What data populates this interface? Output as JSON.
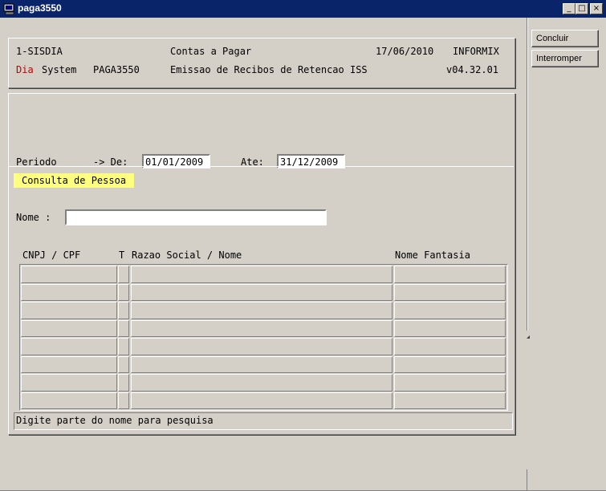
{
  "window": {
    "title": "paga3550",
    "minimize": "_",
    "maximize": "□",
    "close": "×"
  },
  "header": {
    "system": "1-SISDIA",
    "module": "Contas a Pagar",
    "date": "17/06/2010",
    "db": "INFORMIX",
    "brand_red": "Dia",
    "brand_rest": "System",
    "program": "PAGA3550",
    "description": "Emissao de Recibos de Retencao ISS",
    "version": "v04.32.01"
  },
  "period": {
    "label": "Periodo",
    "de_label": "-> De:",
    "de_value": "01/01/2009",
    "ate_label": "Ate:",
    "ate_value": "31/12/2009"
  },
  "consulta": {
    "title": "Consulta de Pessoa"
  },
  "search": {
    "label": "Nome :",
    "value": ""
  },
  "table": {
    "columns": [
      "CNPJ / CPF",
      "T",
      "Razao Social / Nome",
      "Nome Fantasia"
    ],
    "rows": [
      [
        "",
        "",
        "",
        ""
      ],
      [
        "",
        "",
        "",
        ""
      ],
      [
        "",
        "",
        "",
        ""
      ],
      [
        "",
        "",
        "",
        ""
      ],
      [
        "",
        "",
        "",
        ""
      ],
      [
        "",
        "",
        "",
        ""
      ],
      [
        "",
        "",
        "",
        ""
      ],
      [
        "",
        "",
        "",
        ""
      ]
    ]
  },
  "status": {
    "message": "Digite parte do nome para pesquisa"
  },
  "buttons": {
    "concluir": "Concluir",
    "interromper": "Interromper"
  },
  "colors": {
    "title_bar": "#0a246a",
    "brand_red": "#c00000",
    "highlight": "#ffff80",
    "face": "#d4d0c8"
  }
}
